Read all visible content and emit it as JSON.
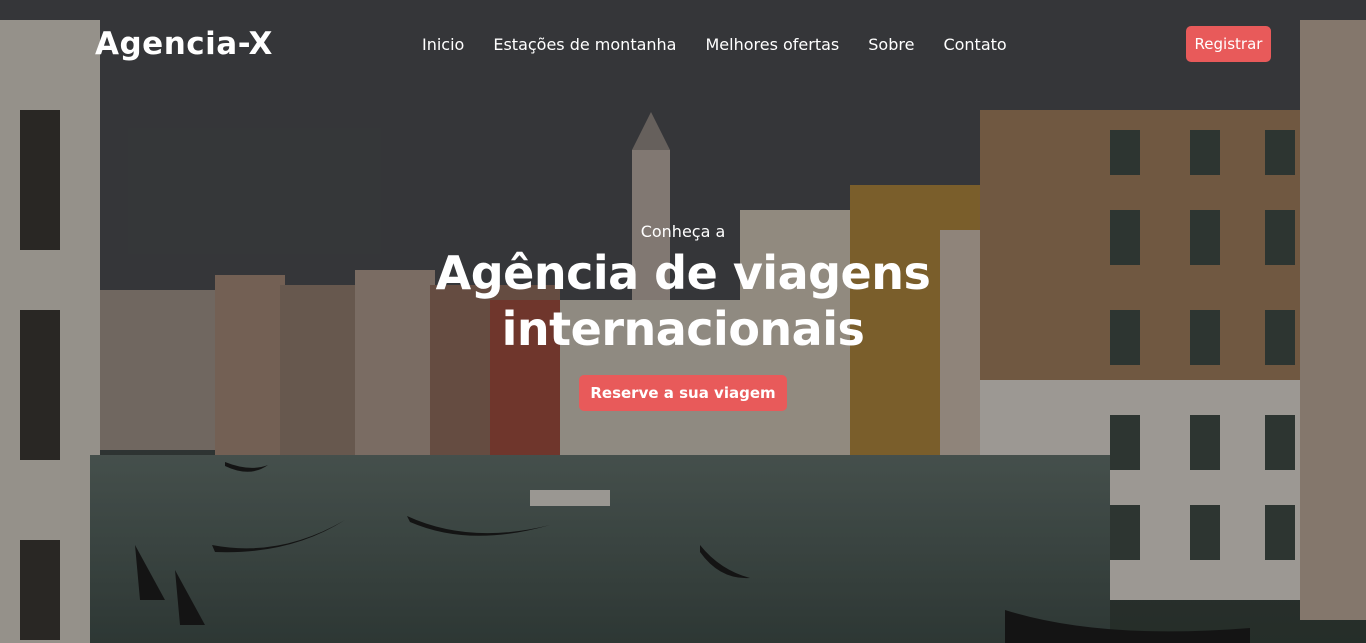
{
  "header": {
    "logo": "Agencia-X",
    "nav": [
      {
        "label": "Inicio"
      },
      {
        "label": "Estações de montanha"
      },
      {
        "label": "Melhores ofertas"
      },
      {
        "label": "Sobre"
      },
      {
        "label": "Contato"
      }
    ],
    "register_label": "Registrar"
  },
  "hero": {
    "subtitle": "Conheça a",
    "title_line1": "Agência de viagens",
    "title_line2": "internacionais",
    "cta_label": "Reserve a sua viagem"
  },
  "colors": {
    "accent": "#e85a5a",
    "text": "#ffffff"
  }
}
